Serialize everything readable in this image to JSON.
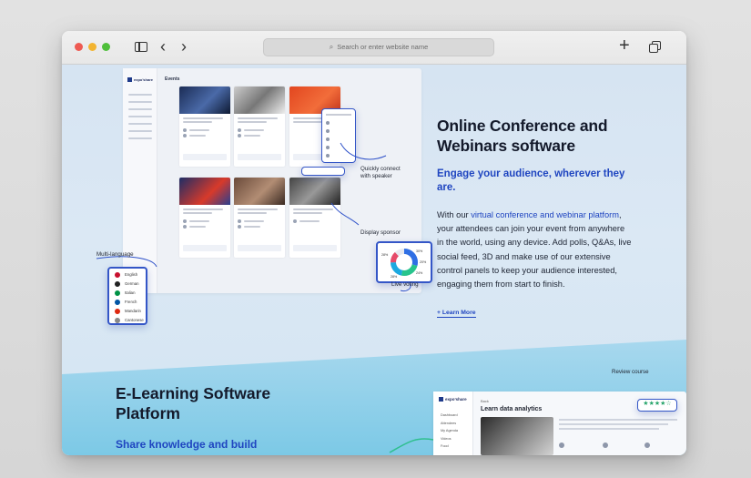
{
  "browser": {
    "address_placeholder": "Search or enter website name"
  },
  "conference": {
    "heading": "Online Conference and Webinars software",
    "subheading": "Engage your audience, wherever they are.",
    "body_before": "With our ",
    "body_link": "virtual conference and webinar platform",
    "body_after": ", your attendees can join your event from anywhere in the world, using any device. Add polls, Q&As, live social feed, 3D and make use of our extensive control panels to keep your audience interested, engaging them from start to finish.",
    "learn_more": "+ Learn More",
    "callouts": {
      "quick_connect": "Quickly connect with speaker",
      "display_sponsor": "Display sponsor",
      "multi_language": "Multi-language",
      "live_voting": "Live voting"
    },
    "mockup": {
      "logo": "expo’share",
      "title": "Events"
    },
    "languages": [
      "English",
      "German",
      "Italian",
      "French",
      "Mandarin",
      "Cantonese"
    ],
    "language_colors": [
      "#c8102e",
      "#222222",
      "#009246",
      "#0055a4",
      "#de2910",
      "#888888"
    ],
    "poll_labels": [
      "28%",
      "30%",
      "20%",
      "24%",
      "28%"
    ]
  },
  "elearning": {
    "heading": "E-Learning Software Platform",
    "subheading": "Share knowledge and build",
    "callout_review": "Review course",
    "mockup": {
      "logo": "expo’share",
      "title": "Learn data analytics",
      "back": "Back",
      "nav": [
        "Dashboard",
        "Attendees",
        "My Agenda",
        "Videos",
        "Food"
      ]
    }
  }
}
